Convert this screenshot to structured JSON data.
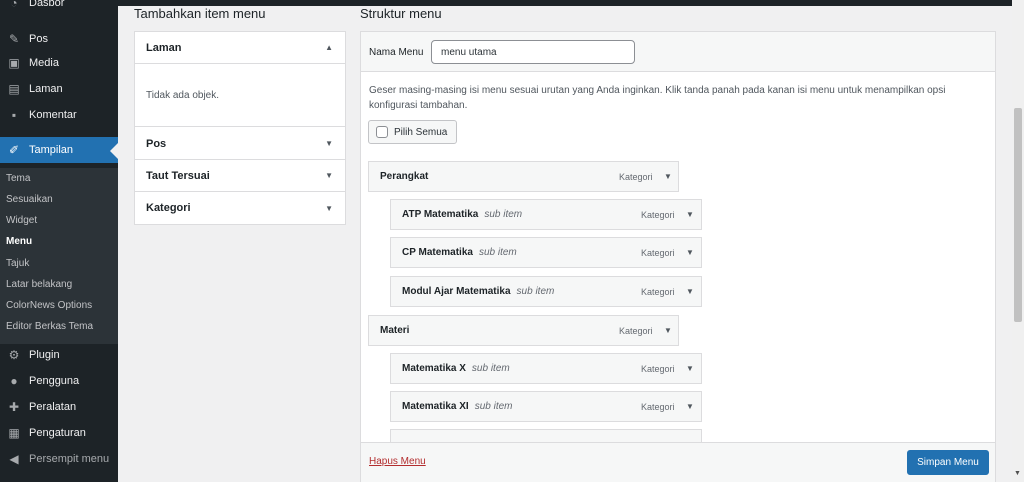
{
  "sidebar": {
    "items": [
      {
        "label": "Dasbor",
        "icon": "gauge-icon"
      },
      {
        "label": "Pos",
        "icon": "pin-icon"
      },
      {
        "label": "Media",
        "icon": "media-icon"
      },
      {
        "label": "Laman",
        "icon": "page-icon"
      },
      {
        "label": "Komentar",
        "icon": "comment-icon"
      },
      {
        "label": "Tampilan",
        "icon": "brush-icon"
      },
      {
        "label": "Plugin",
        "icon": "plugin-icon"
      },
      {
        "label": "Pengguna",
        "icon": "users-icon"
      },
      {
        "label": "Peralatan",
        "icon": "wrench-icon"
      },
      {
        "label": "Pengaturan",
        "icon": "settings-icon"
      },
      {
        "label": "Persempit menu",
        "icon": "collapse-icon"
      }
    ],
    "submenu": [
      "Tema",
      "Sesuaikan",
      "Widget",
      "Menu",
      "Tajuk",
      "Latar belakang",
      "ColorNews Options",
      "Editor Berkas Tema"
    ],
    "active_color": "#2271b1"
  },
  "add_items": {
    "heading": "Tambahkan item menu",
    "sections": [
      {
        "label": "Laman",
        "expanded": true
      },
      {
        "label": "Pos",
        "expanded": false
      },
      {
        "label": "Taut Tersuai",
        "expanded": false
      },
      {
        "label": "Kategori",
        "expanded": false
      }
    ],
    "empty_text": "Tidak ada objek."
  },
  "structure": {
    "heading": "Struktur menu",
    "name_label": "Nama Menu",
    "name_value": "menu utama",
    "instructions": "Geser masing-masing isi menu sesuai urutan yang Anda inginkan. Klik tanda panah pada kanan isi menu untuk menampilkan opsi konfigurasi tambahan.",
    "select_all": "Pilih Semua",
    "items": [
      {
        "title": "Perangkat",
        "sub": "",
        "type": "Kategori"
      },
      {
        "title": "ATP Matematika",
        "sub": "sub item",
        "type": "Kategori"
      },
      {
        "title": "CP Matematika",
        "sub": "sub item",
        "type": "Kategori"
      },
      {
        "title": "Modul Ajar Matematika",
        "sub": "sub item",
        "type": "Kategori"
      },
      {
        "title": "Materi",
        "sub": "",
        "type": "Kategori"
      },
      {
        "title": "Matematika X",
        "sub": "sub item",
        "type": "Kategori"
      },
      {
        "title": "Matematika XI",
        "sub": "sub item",
        "type": "Kategori"
      }
    ],
    "delete_label": "Hapus Menu",
    "save_label": "Simpan Menu"
  }
}
